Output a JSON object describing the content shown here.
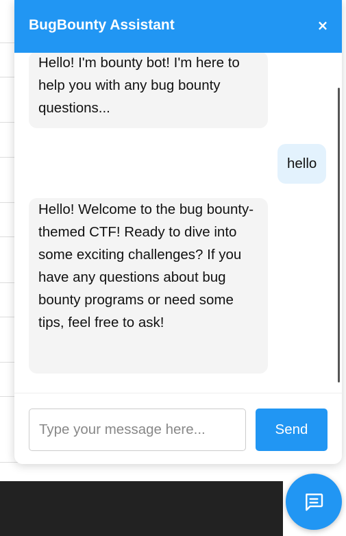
{
  "chat": {
    "title": "BugBounty Assistant",
    "close_glyph": "×",
    "messages": [
      {
        "sender": "bot",
        "text": "Hello! I'm bounty bot! I'm here to help you with any bug bounty questions..."
      },
      {
        "sender": "user",
        "text": "hello"
      },
      {
        "sender": "bot",
        "text": "Hello! Welcome to the bug bounty-themed CTF! Ready to dive into some exciting challenges? If you have any questions about bug bounty programs or need some tips, feel free to ask!"
      }
    ],
    "input": {
      "placeholder": "Type your message here...",
      "value": ""
    },
    "send_label": "Send"
  },
  "fab": {
    "icon": "chat-bubble-icon"
  },
  "colors": {
    "accent": "#2196f3",
    "bot_bubble": "#f4f4f4",
    "user_bubble": "#e3f2fd",
    "footer": "#222222"
  }
}
